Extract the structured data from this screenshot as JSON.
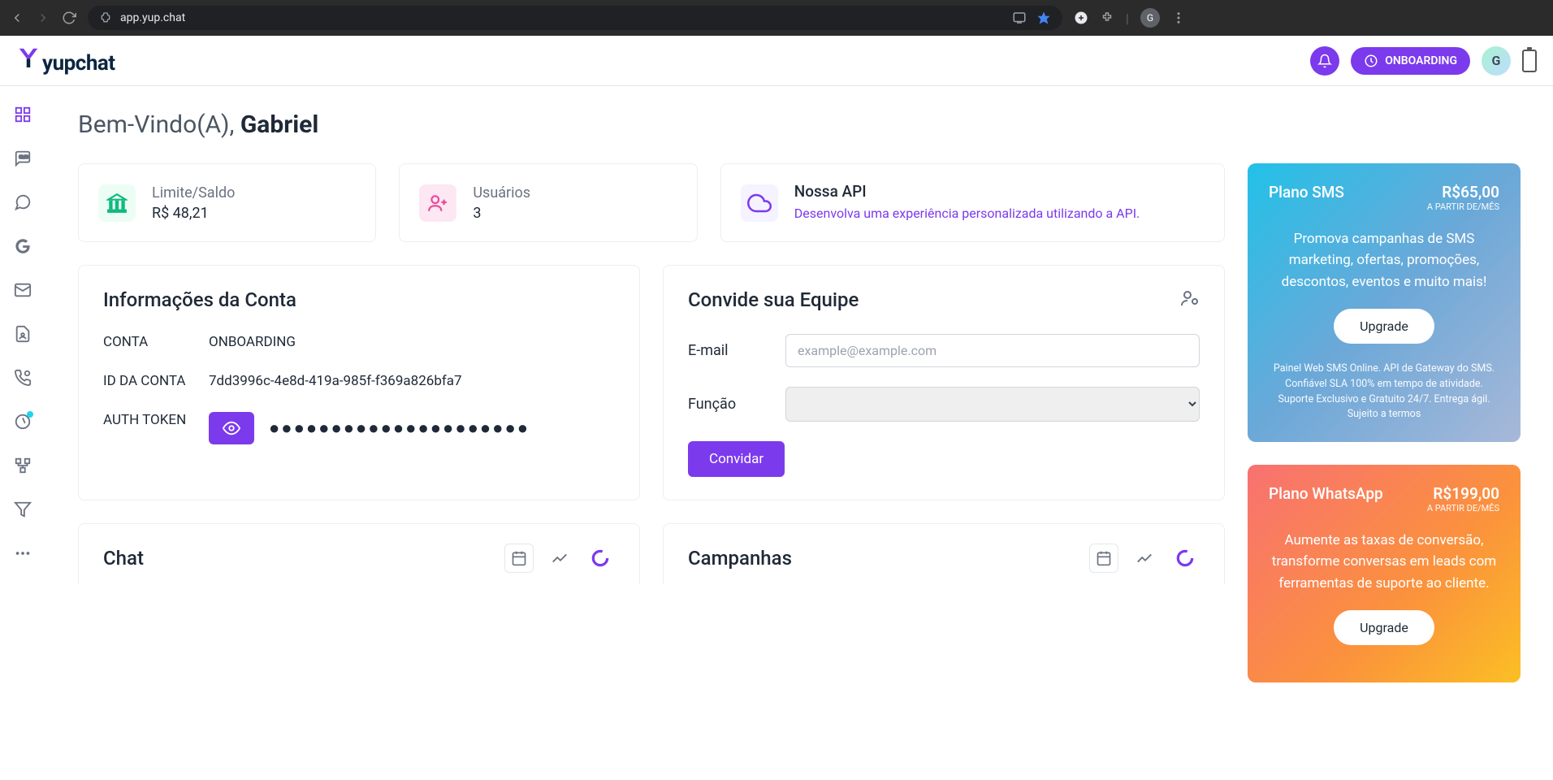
{
  "browser": {
    "url": "app.yup.chat",
    "profile_letter": "G"
  },
  "header": {
    "logo_text": "yupchat",
    "onboarding_label": "ONBOARDING",
    "avatar_letter": "G"
  },
  "welcome": {
    "prefix": "Bem-Vindo(A), ",
    "name": "Gabriel"
  },
  "stats": {
    "balance_label": "Limite/Saldo",
    "balance_value": "R$ 48,21",
    "users_label": "Usuários",
    "users_value": "3",
    "api_title": "Nossa API",
    "api_desc": "Desenvolva uma experiência personalizada utilizando a API."
  },
  "account_info": {
    "title": "Informações da Conta",
    "account_label": "CONTA",
    "account_value": "ONBOARDING",
    "id_label": "ID DA CONTA",
    "id_value": "7dd3996c-4e8d-419a-985f-f369a826bfa7",
    "token_label": "AUTH TOKEN",
    "token_masked": "●●●●●●●●●●●●●●●●●●●●●"
  },
  "invite": {
    "title": "Convide sua Equipe",
    "email_label": "E-mail",
    "email_placeholder": "example@example.com",
    "role_label": "Função",
    "submit_label": "Convidar"
  },
  "charts": {
    "chat_title": "Chat",
    "campaigns_title": "Campanhas"
  },
  "plans": {
    "sms": {
      "name": "Plano SMS",
      "price": "R$65,00",
      "per": "A PARTIR DE/MÊS",
      "desc": "Promova campanhas de SMS marketing, ofertas, promoções, descontos, eventos e muito mais!",
      "cta": "Upgrade",
      "fine": "Painel Web SMS Online. API de Gateway do SMS. Confiável SLA 100% em tempo de atividade. Suporte Exclusivo e Gratuito 24/7. Entrega ágil. Sujeito a termos"
    },
    "wa": {
      "name": "Plano WhatsApp",
      "price": "R$199,00",
      "per": "A PARTIR DE/MÊS",
      "desc": "Aumente as taxas de conversão, transforme conversas em leads com ferramentas de suporte ao cliente.",
      "cta": "Upgrade"
    }
  }
}
